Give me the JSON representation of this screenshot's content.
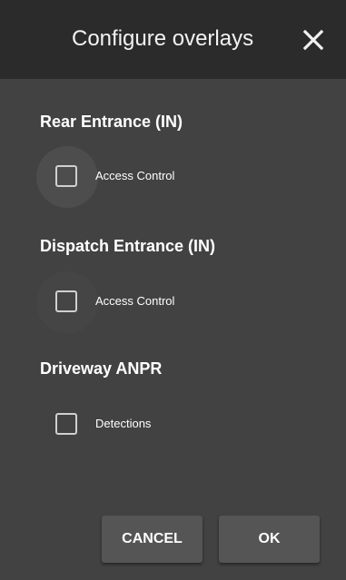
{
  "dialog": {
    "title": "Configure overlays",
    "close_icon": "close-icon"
  },
  "sections": [
    {
      "heading": "Rear Entrance (IN)",
      "option_label": "Access Control",
      "checked": false
    },
    {
      "heading": "Dispatch Entrance (IN)",
      "option_label": "Access Control",
      "checked": false
    },
    {
      "heading": "Driveway ANPR",
      "option_label": "Detections",
      "checked": false
    }
  ],
  "actions": {
    "cancel_label": "CANCEL",
    "ok_label": "OK"
  },
  "colors": {
    "titlebar": "#2b2b2b",
    "background": "#424242",
    "button": "#555555",
    "text": "#ffffff"
  }
}
